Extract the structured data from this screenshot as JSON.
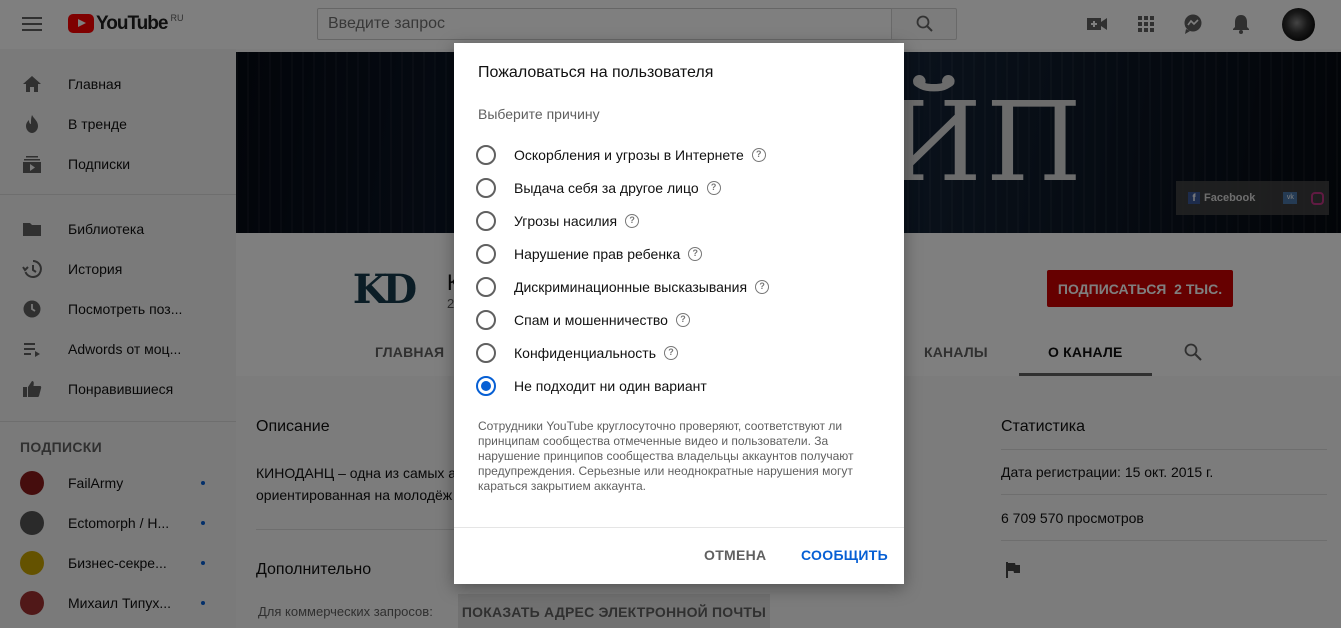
{
  "header": {
    "logo_text": "YouTube",
    "logo_region": "RU",
    "search_placeholder": "Введите запрос"
  },
  "sidebar": {
    "items": [
      {
        "label": "Главная",
        "icon": "home-icon"
      },
      {
        "label": "В тренде",
        "icon": "trending-icon"
      },
      {
        "label": "Подписки",
        "icon": "subscriptions-icon"
      },
      {
        "label": "Библиотека",
        "icon": "library-icon"
      },
      {
        "label": "История",
        "icon": "history-icon"
      },
      {
        "label": "Посмотреть поз...",
        "icon": "watch-later-icon"
      },
      {
        "label": "Adwords от моц...",
        "icon": "playlist-icon"
      },
      {
        "label": "Понравившиеся",
        "icon": "liked-icon"
      }
    ],
    "subscriptions_heading": "ПОДПИСКИ",
    "subscriptions": [
      {
        "label": "FailArmy"
      },
      {
        "label": "Ectomorph / Н..."
      },
      {
        "label": "Бизнес-секре..."
      },
      {
        "label": "Михаил Типух..."
      }
    ]
  },
  "channel": {
    "logo_text": "KD",
    "name_partial": "К",
    "subs_partial": "2",
    "subscribe_label": "ПОДПИСАТЬСЯ  2 ТЫС.",
    "banner_text": "ЙП",
    "social": {
      "facebook": "Facebook"
    },
    "tabs": [
      {
        "label": "ГЛАВНАЯ"
      },
      {
        "label": "КАНАЛЫ"
      },
      {
        "label": "О КАНАЛЕ"
      }
    ]
  },
  "about": {
    "description_title": "Описание",
    "description_line1": "КИНОДАНЦ – одна из самых а",
    "description_line2": "ориентированная на молодёж",
    "additional_title": "Дополнительно",
    "commercial_label": "Для коммерческих запросов:",
    "email_button": "ПОКАЗАТЬ АДРЕС ЭЛЕКТРОННОЙ ПОЧТЫ",
    "stats_title": "Статистика",
    "registered": "Дата регистрации: 15 окт. 2015 г.",
    "views": "6 709 570 просмотров"
  },
  "dialog": {
    "title": "Пожаловаться на пользователя",
    "subtitle": "Выберите причину",
    "options": [
      {
        "label": "Оскорбления и угрозы в Интернете",
        "help": true,
        "selected": false
      },
      {
        "label": "Выдача себя за другое лицо",
        "help": true,
        "selected": false
      },
      {
        "label": "Угрозы насилия",
        "help": true,
        "selected": false
      },
      {
        "label": "Нарушение прав ребенка",
        "help": true,
        "selected": false
      },
      {
        "label": "Дискриминационные высказывания",
        "help": true,
        "selected": false
      },
      {
        "label": "Спам и мошенничество",
        "help": true,
        "selected": false
      },
      {
        "label": "Конфиденциальность",
        "help": true,
        "selected": false
      },
      {
        "label": "Не подходит ни один вариант",
        "help": false,
        "selected": true
      }
    ],
    "help_glyph": "?",
    "note": "Сотрудники YouTube круглосуточно проверяют, соответствуют ли принципам сообщества отмеченные видео и пользователи. За нарушение принципов сообщества владельцы аккаунтов получают предупреждения. Серьезные или неоднократные нарушения могут караться закрытием аккаунта.",
    "cancel_label": "ОТМЕНА",
    "submit_label": "СООБЩИТЬ",
    "accent_color": "#065fd4"
  }
}
